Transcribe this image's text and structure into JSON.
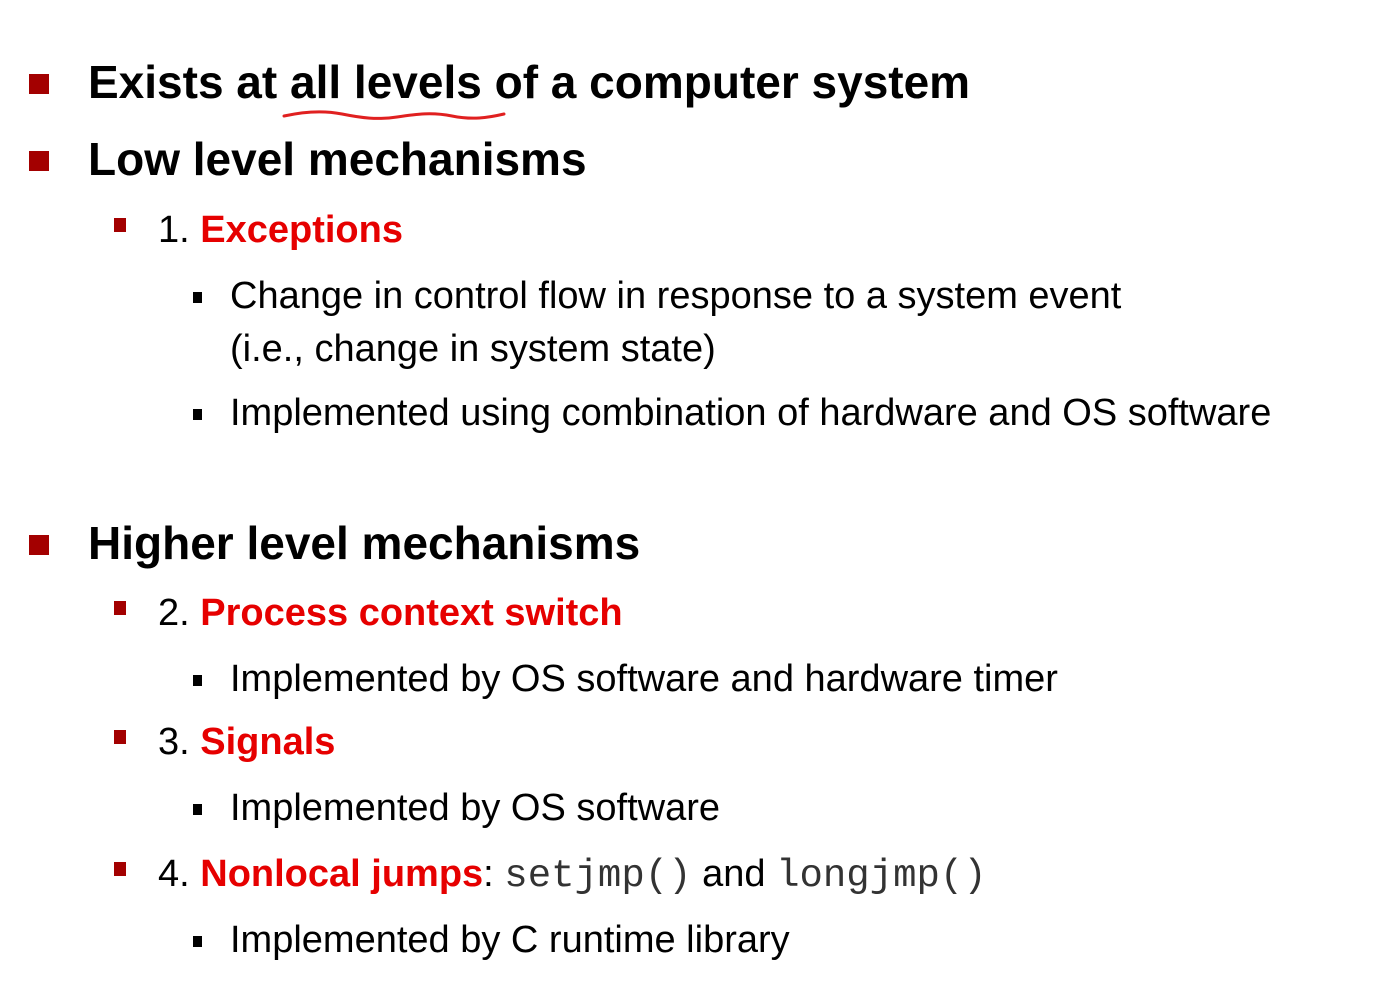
{
  "colors": {
    "bullet_level1": "#a30000",
    "bullet_level2": "#a30000",
    "bullet_level3": "#000000",
    "highlight": "#e60000",
    "annotation": "#e02020"
  },
  "items": {
    "exists": {
      "pre": "Exists at ",
      "underlined": "all levels",
      "post": " of a computer system"
    },
    "low_level": {
      "label": "Low level mechanisms",
      "exceptions": {
        "number": "1. ",
        "name": "Exceptions",
        "details": [
          "Change in control flow in response to a system event",
          "(i.e.,  change in system state)",
          "Implemented using combination of hardware and OS software"
        ]
      }
    },
    "higher_level": {
      "label": "Higher level mechanisms",
      "context_switch": {
        "number": "2. ",
        "name": "Process context switch",
        "detail": "Implemented by OS software and hardware timer"
      },
      "signals": {
        "number": "3. ",
        "name": "Signals",
        "detail": "Implemented by OS software"
      },
      "nonlocal_jumps": {
        "number": "4. ",
        "name": "Nonlocal jumps",
        "colon": ": ",
        "code1": "setjmp()",
        "and": " and ",
        "code2": "longjmp()",
        "detail": "Implemented by C runtime library"
      }
    }
  }
}
